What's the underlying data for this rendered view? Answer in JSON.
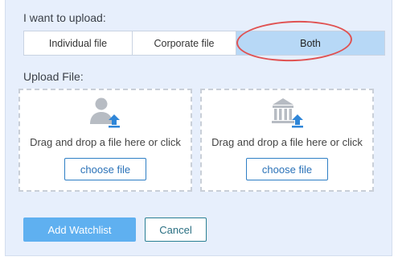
{
  "upload_type": {
    "label": "I want to upload:",
    "options": [
      "Individual file",
      "Corporate file",
      "Both"
    ],
    "selected": "Both"
  },
  "upload_file": {
    "label": "Upload File:",
    "dropzones": [
      {
        "icon": "person-upload-icon",
        "text": "Drag and drop a file here or click",
        "button": "choose file"
      },
      {
        "icon": "bank-upload-icon",
        "text": "Drag and drop a file here or click",
        "button": "choose file"
      }
    ]
  },
  "actions": {
    "primary": "Add Watchlist",
    "secondary": "Cancel"
  },
  "colors": {
    "panel_bg": "#e7effc",
    "selected_option": "#b7d8f6",
    "highlight_circle": "#e05252",
    "upload_arrow": "#2f86d8",
    "primary_button": "#5fb0f0"
  }
}
